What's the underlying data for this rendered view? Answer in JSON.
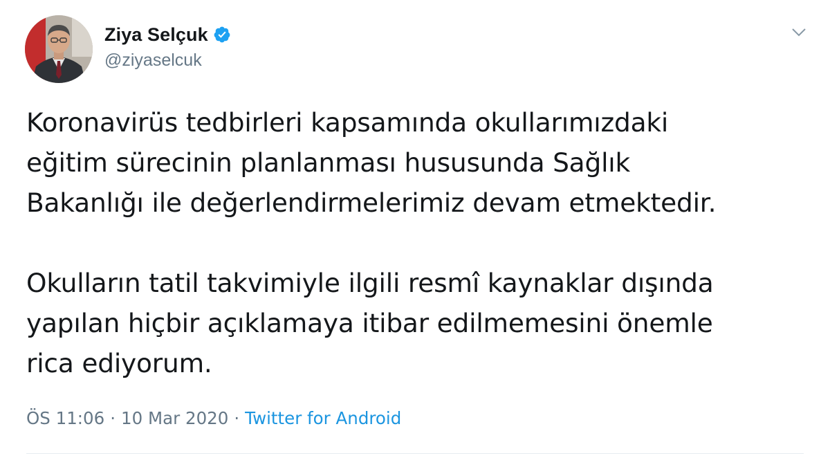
{
  "author": {
    "display_name": "Ziya Selçuk",
    "handle": "@ziyaselcuk",
    "verified": true,
    "avatar_icon": "profile-photo"
  },
  "tweet": {
    "text": "Koronavirüs tedbirleri kapsamında okullarımızdaki\neğitim sürecinin planlanması hususunda Sağlık\nBakanlığı ile değerlendirmelerimiz devam etmektedir.\n\nOkulların tatil takvimiyle ilgili resmî kaynaklar dışında\nyapılan hiçbir açıklamaya itibar edilmemesini önemle\nrica ediyorum."
  },
  "meta": {
    "time": "ÖS 11:06",
    "separator": "·",
    "date": "10 Mar 2020",
    "source": "Twitter for Android"
  },
  "colors": {
    "text": "#14171a",
    "secondary": "#657786",
    "link": "#1b95e0",
    "verified": "#1da1f2",
    "divider": "#e6ecf0"
  },
  "icons": {
    "verified": "verified-badge-icon",
    "menu": "chevron-down-icon"
  }
}
